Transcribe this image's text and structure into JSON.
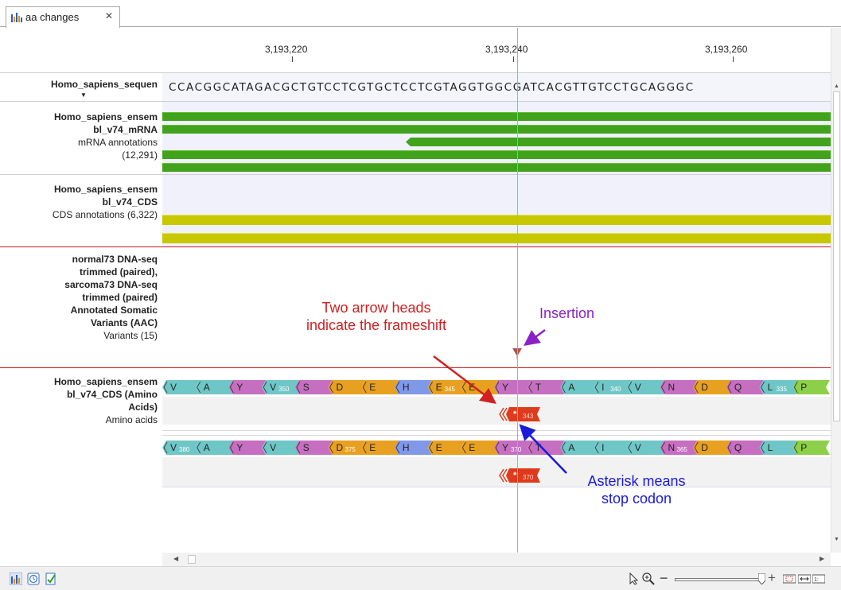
{
  "tab": {
    "title": "aa changes",
    "close_glyph": "✕"
  },
  "ruler": {
    "ticks": [
      "3,193,220",
      "3,193,240",
      "3,193,260"
    ]
  },
  "sequence_track": {
    "name": "Homo_sapiens_sequen",
    "sequence": "CCACGGCATAGACGCTGTCCTCGTGCTCCTCGTAGGTGGCGATCACGTTGTCCTGCAGGGC"
  },
  "mrna_track": {
    "name_line1": "Homo_sapiens_ensem",
    "name_line2": "bl_v74_mRNA",
    "desc_line1": "mRNA annotations",
    "desc_line2": "(12,291)"
  },
  "cds_track": {
    "name_line1": "Homo_sapiens_ensem",
    "name_line2": "bl_v74_CDS",
    "desc": "CDS annotations (6,322)"
  },
  "variant_track": {
    "lines": [
      "normal73 DNA-seq",
      "trimmed (paired),",
      "sarcoma73 DNA-seq",
      "trimmed (paired)",
      "Annotated Somatic",
      "Variants (AAC)"
    ],
    "desc": "Variants (15)"
  },
  "aa_track": {
    "name_line1": "Homo_sapiens_ensem",
    "name_line2": "bl_v74_CDS (Amino",
    "name_line3": "Acids)",
    "desc": "Amino acids",
    "row1": [
      {
        "aa": "V",
        "c": "#6fc6c6",
        "n": ""
      },
      {
        "aa": "A",
        "c": "#6fc6c6",
        "n": ""
      },
      {
        "aa": "Y",
        "c": "#c66fc0",
        "n": ""
      },
      {
        "aa": "V",
        "c": "#6fc6c6",
        "n": "350"
      },
      {
        "aa": "S",
        "c": "#c66fc0",
        "n": ""
      },
      {
        "aa": "D",
        "c": "#e8a020",
        "n": ""
      },
      {
        "aa": "E",
        "c": "#e8a020",
        "n": ""
      },
      {
        "aa": "H",
        "c": "#8098e8",
        "n": ""
      },
      {
        "aa": "E",
        "c": "#e8a020",
        "n": "345"
      },
      {
        "aa": "E",
        "c": "#e8a020",
        "n": ""
      },
      {
        "aa": "Y",
        "c": "#c66fc0",
        "n": ""
      },
      {
        "aa": "T",
        "c": "#c66fc0",
        "n": ""
      },
      {
        "aa": "A",
        "c": "#6fc6c6",
        "n": ""
      },
      {
        "aa": "I",
        "c": "#6fc6c6",
        "n": "340"
      },
      {
        "aa": "V",
        "c": "#6fc6c6",
        "n": ""
      },
      {
        "aa": "N",
        "c": "#c66fc0",
        "n": ""
      },
      {
        "aa": "D",
        "c": "#e8a020",
        "n": ""
      },
      {
        "aa": "Q",
        "c": "#c66fc0",
        "n": ""
      },
      {
        "aa": "L",
        "c": "#6fc6c6",
        "n": "335"
      },
      {
        "aa": "P",
        "c": "#8bd048",
        "n": ""
      }
    ],
    "row2": [
      {
        "aa": "V",
        "c": "#6fc6c6",
        "n": "380"
      },
      {
        "aa": "A",
        "c": "#6fc6c6",
        "n": ""
      },
      {
        "aa": "Y",
        "c": "#c66fc0",
        "n": ""
      },
      {
        "aa": "V",
        "c": "#6fc6c6",
        "n": ""
      },
      {
        "aa": "S",
        "c": "#c66fc0",
        "n": ""
      },
      {
        "aa": "D",
        "c": "#e8a020",
        "n": "375"
      },
      {
        "aa": "E",
        "c": "#e8a020",
        "n": ""
      },
      {
        "aa": "H",
        "c": "#8098e8",
        "n": ""
      },
      {
        "aa": "E",
        "c": "#e8a020",
        "n": ""
      },
      {
        "aa": "E",
        "c": "#e8a020",
        "n": ""
      },
      {
        "aa": "Y",
        "c": "#c66fc0",
        "n": "370"
      },
      {
        "aa": "T",
        "c": "#c66fc0",
        "n": ""
      },
      {
        "aa": "A",
        "c": "#6fc6c6",
        "n": ""
      },
      {
        "aa": "I",
        "c": "#6fc6c6",
        "n": ""
      },
      {
        "aa": "V",
        "c": "#6fc6c6",
        "n": ""
      },
      {
        "aa": "N",
        "c": "#c66fc0",
        "n": "365"
      },
      {
        "aa": "D",
        "c": "#e8a020",
        "n": ""
      },
      {
        "aa": "Q",
        "c": "#c66fc0",
        "n": ""
      },
      {
        "aa": "L",
        "c": "#6fc6c6",
        "n": ""
      },
      {
        "aa": "P",
        "c": "#8bd048",
        "n": ""
      }
    ],
    "stop1": {
      "symbol": "*",
      "num": "343"
    },
    "stop2": {
      "symbol": "*",
      "num": "370"
    }
  },
  "annotations": {
    "frameshift_line1": "Two arrow heads",
    "frameshift_line2": "indicate the frameshift",
    "insertion": "Insertion",
    "stop_line1": "Asterisk means",
    "stop_line2": "stop codon"
  },
  "colors": {
    "red_annotation": "#d02020",
    "purple_annotation": "#8a22c8",
    "blue_annotation": "#1a1ad8"
  }
}
